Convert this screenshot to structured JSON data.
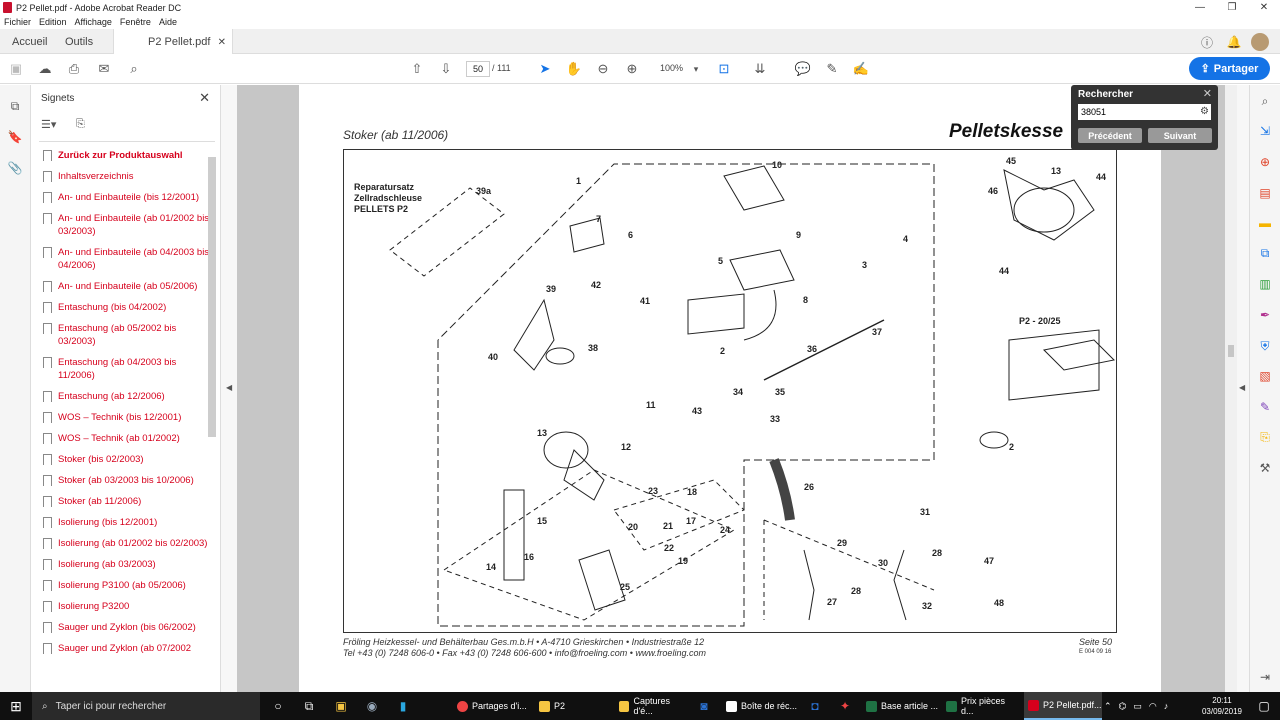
{
  "window": {
    "title": "P2 Pellet.pdf - Adobe Acrobat Reader DC"
  },
  "menu": [
    "Fichier",
    "Edition",
    "Affichage",
    "Fenêtre",
    "Aide"
  ],
  "tabs": {
    "home": "Accueil",
    "tools": "Outils",
    "doc": "P2 Pellet.pdf"
  },
  "toolbar": {
    "page_current": "50",
    "page_total": "/ 111",
    "zoom": "100%",
    "share": "Partager"
  },
  "bookmarks_panel": {
    "title": "Signets",
    "items": [
      "Zurück zur Produktauswahl",
      "Inhaltsverzeichnis",
      "An- und Einbauteile (bis 12/2001)",
      "An- und Einbauteile (ab 01/2002 bis 03/2003)",
      "An- und Einbauteile (ab 04/2003 bis 04/2006)",
      "An- und Einbauteile (ab 05/2006)",
      "Entaschung (bis 04/2002)",
      "Entaschung (ab 05/2002 bis 03/2003)",
      "Entaschung (ab 04/2003 bis 11/2006)",
      "Entaschung (ab 12/2006)",
      "WOS – Technik (bis 12/2001)",
      "WOS – Technik (ab 01/2002)",
      "Stoker (bis 02/2003)",
      "Stoker (ab 03/2003 bis 10/2006)",
      "Stoker (ab 11/2006)",
      "Isolierung (bis 12/2001)",
      "Isolierung (ab 01/2002 bis 02/2003)",
      "Isolierung (ab 03/2003)",
      "Isolierung P3100 (ab 05/2006)",
      "Isolierung P3200",
      "Sauger und Zyklon (bis 06/2002)",
      "Sauger und Zyklon (ab 07/2002"
    ]
  },
  "pdf_page": {
    "header_left": "Stoker (ab 11/2006)",
    "header_right": "Pelletskesse",
    "repair_title": [
      "Reparatursatz",
      "Zellradschleuse",
      "PELLETS P2"
    ],
    "variant_label": "P2 - 20/25",
    "footer_line1": "Fröling Heizkessel- und Behälterbau Ges.m.b.H   •   A-4710 Grieskirchen   •   Industriestraße 12",
    "footer_line2": "Tel +43 (0) 7248 606-0   •   Fax +43 (0) 7248 606-600   •   info@froeling.com   •   www.froeling.com",
    "page_label": "Seite 50",
    "doc_code": "E 004 09 16",
    "part_numbers": [
      "39a",
      "1",
      "10",
      "7",
      "6",
      "5",
      "9",
      "3",
      "4",
      "42",
      "41",
      "39",
      "8",
      "2",
      "37",
      "38",
      "40",
      "36",
      "34",
      "35",
      "11",
      "43",
      "33",
      "13",
      "12",
      "26",
      "23",
      "18",
      "20",
      "21",
      "17",
      "22",
      "24",
      "15",
      "16",
      "19",
      "14",
      "25",
      "29",
      "27",
      "28",
      "31",
      "30",
      "28",
      "32",
      "47",
      "48",
      "45",
      "13",
      "44",
      "46",
      "44",
      "2"
    ]
  },
  "search": {
    "label": "Rechercher",
    "value": "38051",
    "prev": "Précédent",
    "next": "Suivant"
  },
  "taskbar": {
    "search_placeholder": "Taper ici pour rechercher",
    "apps": [
      "Partages d'i...",
      "P2",
      "Captures d'é...",
      "Boîte de réc...",
      "Base article ...",
      "Prix pièces d...",
      "P2 Pellet.pdf..."
    ],
    "time": "20:11",
    "date": "03/09/2019"
  }
}
